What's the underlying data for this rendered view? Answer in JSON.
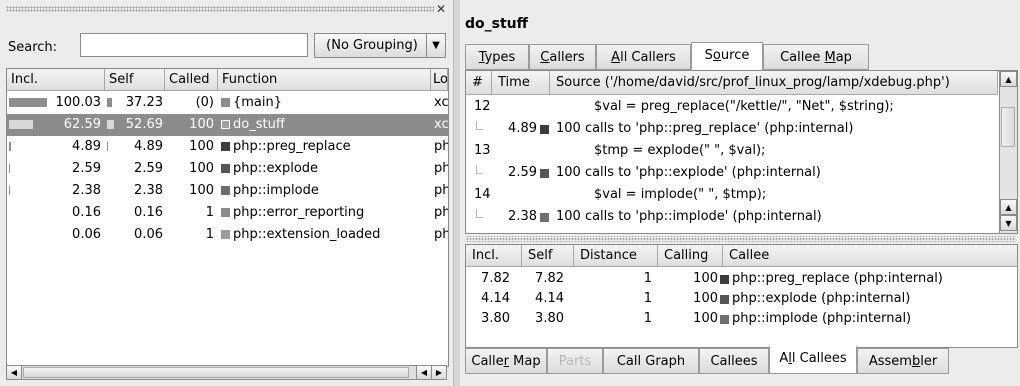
{
  "left_pane": {
    "search_label": "Search:",
    "search_value": "",
    "grouping": "(No Grouping)",
    "columns": [
      "Incl.",
      "Self",
      "Called",
      "Function",
      "Lo"
    ],
    "rows": [
      {
        "incl": "100.03",
        "incl_frac": 1.0,
        "self": "37.23",
        "self_frac": 0.37,
        "called": "(0)",
        "function": "{main}",
        "location": "xc",
        "color": "#8d8d8d",
        "selected": false
      },
      {
        "incl": "62.59",
        "incl_frac": 0.63,
        "self": "52.69",
        "self_frac": 0.53,
        "called": "100",
        "function": "do_stuff",
        "location": "xc",
        "color": "#a0a0a0",
        "selected": true
      },
      {
        "incl": "4.89",
        "incl_frac": 0.05,
        "self": "4.89",
        "self_frac": 0.05,
        "called": "100",
        "function": "php::preg_replace",
        "location": "ph",
        "color": "#3c3c3c",
        "selected": false
      },
      {
        "incl": "2.59",
        "incl_frac": 0.03,
        "self": "2.59",
        "self_frac": 0.03,
        "called": "100",
        "function": "php::explode",
        "location": "ph",
        "color": "#555555",
        "selected": false
      },
      {
        "incl": "2.38",
        "incl_frac": 0.02,
        "self": "2.38",
        "self_frac": 0.02,
        "called": "100",
        "function": "php::implode",
        "location": "ph",
        "color": "#6e6e6e",
        "selected": false
      },
      {
        "incl": "0.16",
        "incl_frac": 0.0,
        "self": "0.16",
        "self_frac": 0.0,
        "called": "1",
        "function": "php::error_reporting",
        "location": "ph",
        "color": "#8a8a8a",
        "selected": false
      },
      {
        "incl": "0.06",
        "incl_frac": 0.0,
        "self": "0.06",
        "self_frac": 0.0,
        "called": "1",
        "function": "php::extension_loaded",
        "location": "ph",
        "color": "#9a9a9a",
        "selected": false
      }
    ]
  },
  "right_pane": {
    "function_name": "do_stuff",
    "top_tabs": [
      "Types",
      "Callers",
      "All Callers",
      "Source",
      "Callee Map"
    ],
    "active_top_tab": "Source",
    "source": {
      "columns": [
        "#",
        "Time",
        "Source ('/home/david/src/prof_linux_prog/lamp/xdebug.php')"
      ],
      "rows": [
        {
          "line": "12",
          "time": "",
          "text": "$val = preg_replace(\"/kettle/\", \"Net\", $string);",
          "kind": "code"
        },
        {
          "line": "",
          "time": "4.89",
          "text": "100 calls to 'php::preg_replace' (php:internal)",
          "kind": "call",
          "color": "#3c3c3c"
        },
        {
          "line": "13",
          "time": "",
          "text": "$tmp = explode(\" \", $val);",
          "kind": "code"
        },
        {
          "line": "",
          "time": "2.59",
          "text": "100 calls to 'php::explode' (php:internal)",
          "kind": "call",
          "color": "#555555"
        },
        {
          "line": "14",
          "time": "",
          "text": "$val = implode(\" \", $tmp);",
          "kind": "code"
        },
        {
          "line": "",
          "time": "2.38",
          "text": "100 calls to 'php::implode' (php:internal)",
          "kind": "call",
          "color": "#6e6e6e"
        }
      ]
    },
    "callees": {
      "columns": [
        "Incl.",
        "Self",
        "Distance",
        "Calling",
        "Callee"
      ],
      "rows": [
        {
          "incl": "7.82",
          "self": "7.82",
          "distance": "1",
          "calling": "100",
          "callee": "php::preg_replace (php:internal)",
          "color": "#3c3c3c"
        },
        {
          "incl": "4.14",
          "self": "4.14",
          "distance": "1",
          "calling": "100",
          "callee": "php::explode (php:internal)",
          "color": "#555555"
        },
        {
          "incl": "3.80",
          "self": "3.80",
          "distance": "1",
          "calling": "100",
          "callee": "php::implode (php:internal)",
          "color": "#6e6e6e"
        }
      ]
    },
    "bottom_tabs": [
      "Caller Map",
      "Parts",
      "Call Graph",
      "Callees",
      "All Callees",
      "Assembler"
    ],
    "active_bottom_tab": "All Callees",
    "disabled_bottom_tab": "Parts"
  }
}
